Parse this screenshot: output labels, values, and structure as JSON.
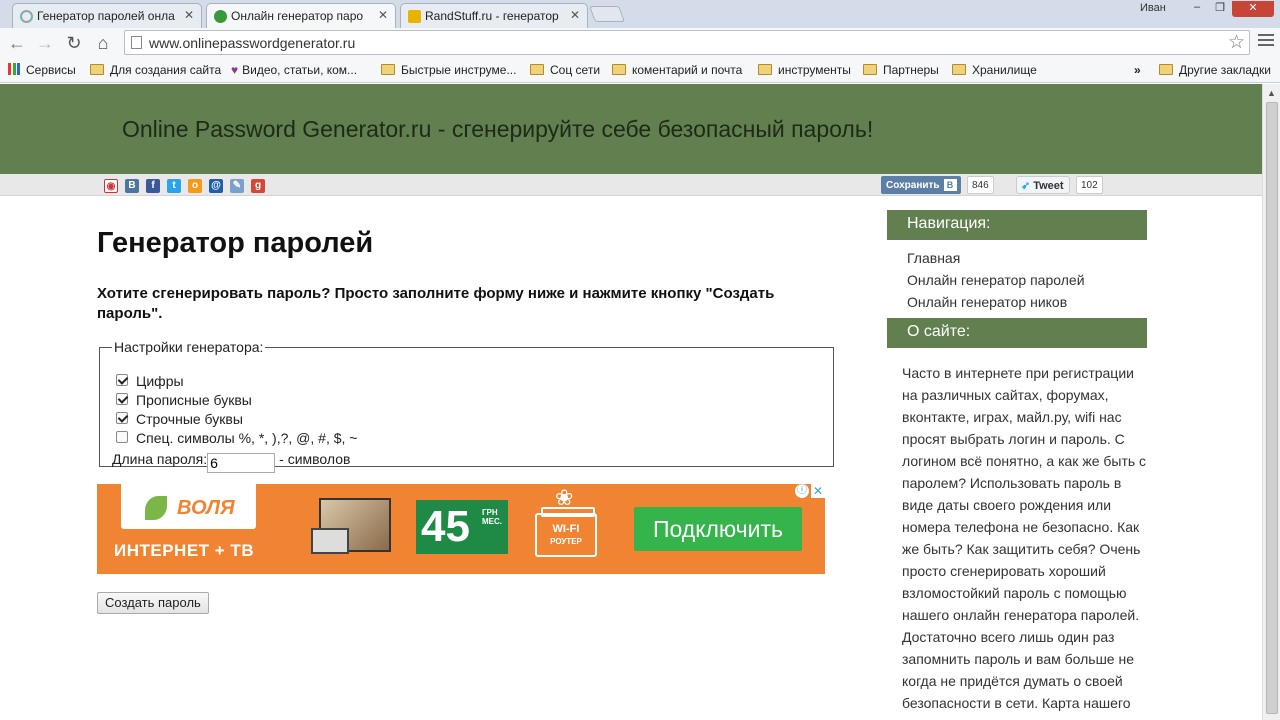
{
  "browser": {
    "tabs": [
      {
        "label": "Генератор паролей онла",
        "active": false
      },
      {
        "label": "Онлайн генератор паро",
        "active": true
      },
      {
        "label": "RandStuff.ru - генератор",
        "active": false
      }
    ],
    "user": "Иван",
    "url": "www.onlinepasswordgenerator.ru",
    "bookmarks": [
      "Сервисы",
      "Для создания сайта",
      "Видео, статьи, ком...",
      "Быстрые инструме...",
      "Соц сети",
      "коментарий и почта",
      "инструменты",
      "Партнеры",
      "Хранилище"
    ],
    "bookmarks_more": "»",
    "other_bookmarks": "Другие закладки"
  },
  "site": {
    "title": "Online Password Generator.ru - сгенерируйте себе безопасный пароль!"
  },
  "share": {
    "vk_save": "Сохранить",
    "vk_letter": "В",
    "vk_count": "846",
    "tweet_label": "Tweet",
    "tweet_count": "102"
  },
  "main": {
    "heading": "Генератор паролей",
    "intro": "Хотите сгенерировать пароль? Просто заполните форму ниже и нажмите кнопку \"Создать пароль\".",
    "settings_legend": "Настройки генератора:",
    "options": [
      {
        "label": "Цифры",
        "checked": true
      },
      {
        "label": "Прописные буквы",
        "checked": true
      },
      {
        "label": "Строчные буквы",
        "checked": true
      },
      {
        "label": "Спец. символы %, *, ),?, @, #, $, ~",
        "checked": false
      }
    ],
    "length_label": "Длина пароля:",
    "length_value": "6",
    "length_suffix": "- символов",
    "submit_label": "Создать пароль"
  },
  "ad": {
    "brand": "ВОЛЯ",
    "tagline": "ИНТЕРНЕТ + ТВ",
    "price": "45",
    "price_unit_1": "ГРН",
    "price_unit_2": "МЕС.",
    "gift_title": "WI-FI",
    "gift_sub": "РОУТЕР",
    "cta": "Подключить",
    "info_icon": "ⓘ",
    "close_icon": "✕"
  },
  "sidebar": {
    "nav_heading": "Навигация:",
    "links": [
      "Главная",
      "Онлайн генератор паролей",
      "Онлайн генератор ников"
    ],
    "about_heading": "О сайте:",
    "about_text": "Часто в интернете при регистрации на различных сайтах, форумах, вконтакте, играх, майл.ру, wifi нас просят выбрать логин и пароль. С логином всё понятно, а как же быть с паролем? Использовать пароль в виде даты своего рождения или номера телефона не безопасно. Как же быть? Как защитить себя? Очень просто сгенерировать хороший взломостойкий пароль с помощью нашего онлайн генератора паролей. Достаточно всего лишь один раз запомнить пароль и вам больше не когда не придётся думать о своей безопасности в сети. Карта нашего"
  },
  "colors": {
    "header_green": "#627f4f",
    "ad_orange": "#f08432",
    "cta_green": "#34b44a"
  }
}
